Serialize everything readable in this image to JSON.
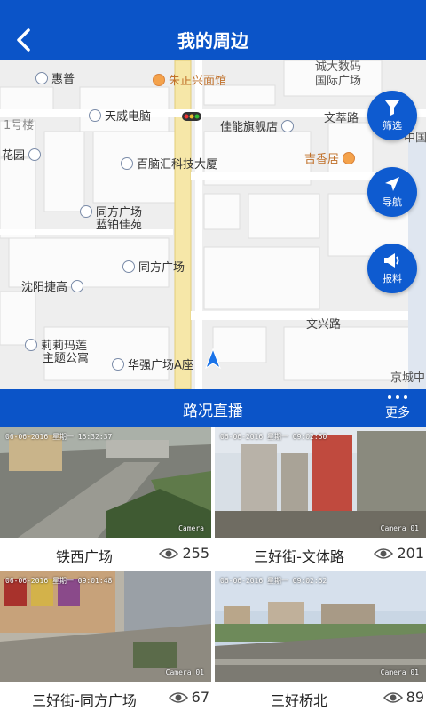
{
  "header": {
    "title": "我的周边"
  },
  "map": {
    "pois": [
      {
        "name": "惠普",
        "style": "blue"
      },
      {
        "name": "朱正兴面馆",
        "style": "orange"
      },
      {
        "name": "诚大数码",
        "style": "plain"
      },
      {
        "name": "国际广场",
        "style": "plain"
      },
      {
        "name": "1号楼",
        "style": "plain"
      },
      {
        "name": "天威电脑",
        "style": "blue"
      },
      {
        "name": "佳能旗舰店",
        "style": "blue"
      },
      {
        "name": "文萃路",
        "style": "street"
      },
      {
        "name": "中国",
        "style": "plain"
      },
      {
        "name": "花园",
        "style": "blue"
      },
      {
        "name": "百脑汇科技大厦",
        "style": "blue"
      },
      {
        "name": "吉香居",
        "style": "orange"
      },
      {
        "name": "同方广场",
        "style": "blue"
      },
      {
        "name": "蓝铂佳苑",
        "style": "plain"
      },
      {
        "name": "同方广场",
        "style": "blue"
      },
      {
        "name": "沈阳捷高",
        "style": "blue"
      },
      {
        "name": "文兴路",
        "style": "street"
      },
      {
        "name": "莉莉玛莲",
        "style": "blue"
      },
      {
        "name": "主题公寓",
        "style": "plain"
      },
      {
        "name": "华强广场A座",
        "style": "blue"
      },
      {
        "name": "京城中",
        "style": "plain"
      }
    ],
    "actions": {
      "filter": "筛选",
      "navigate": "导航",
      "report": "报料"
    }
  },
  "section": {
    "title": "路况直播",
    "more": "更多"
  },
  "cameras": [
    {
      "name": "铁西广场",
      "views": "255",
      "timestamp": "06-06-2016 星期一 15:32:37",
      "caption": "Camera"
    },
    {
      "name": "三好街-文体路",
      "views": "201",
      "timestamp": "06-06-2016 星期一 09:02:50",
      "caption": "Camera 01"
    },
    {
      "name": "三好街-同方广场",
      "views": "67",
      "timestamp": "06-06-2016 星期一 09:01:48",
      "caption": "Camera 01"
    },
    {
      "name": "三好桥北",
      "views": "89",
      "timestamp": "06-06-2016 星期一 09:02:52",
      "caption": "Camera 01"
    }
  ],
  "colors": {
    "primary": "#0b54c8",
    "fab": "#0e5bd0",
    "poi_orange": "#c0702a"
  }
}
